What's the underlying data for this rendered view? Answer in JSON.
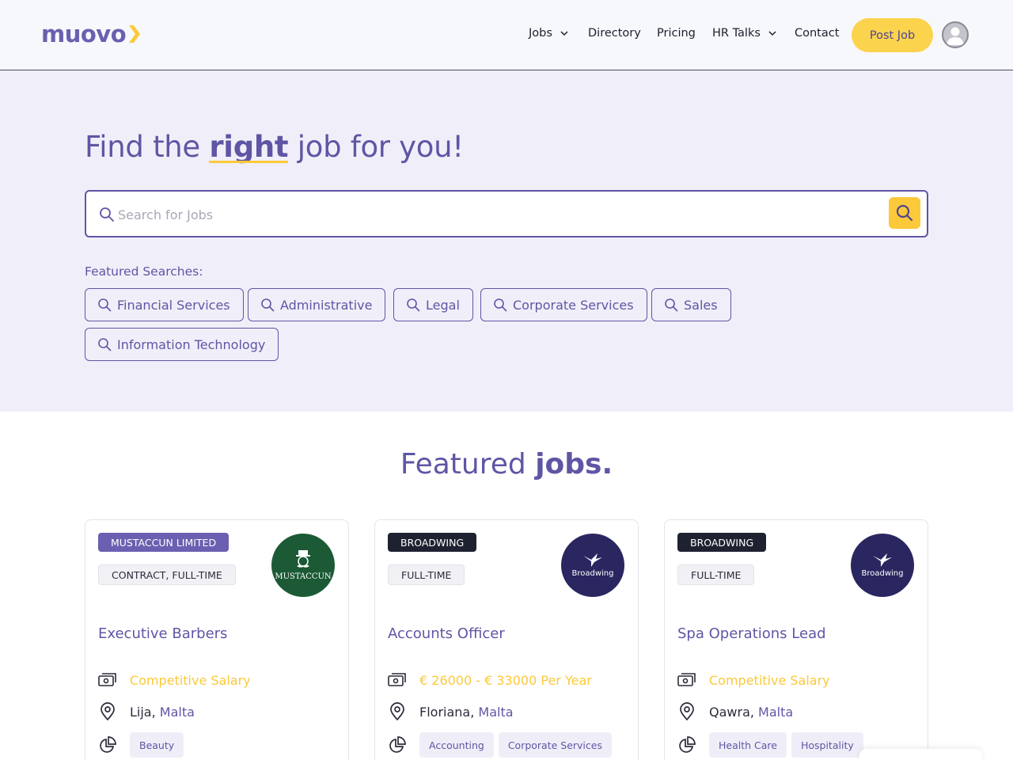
{
  "header": {
    "logo_text": "muovo",
    "nav": [
      {
        "label": "Jobs",
        "has_dropdown": true
      },
      {
        "label": "Directory",
        "has_dropdown": false
      },
      {
        "label": "Pricing",
        "has_dropdown": false
      },
      {
        "label": "HR Talks",
        "has_dropdown": true
      },
      {
        "label": "Contact",
        "has_dropdown": false
      }
    ],
    "post_job_label": "Post Job",
    "avatar_icon": "user-avatar-icon"
  },
  "hero": {
    "title_before": "Find the ",
    "title_highlight": "right",
    "title_after": " job for you!",
    "search": {
      "placeholder": "Search for Jobs",
      "value": ""
    },
    "featured_label": "Featured Searches:",
    "featured_searches": [
      "Financial Services",
      "Administrative",
      "Legal",
      "Corporate Services",
      "Sales",
      "Information Technology"
    ]
  },
  "featured": {
    "title_regular": "Featured ",
    "title_bold": "jobs."
  },
  "jobs": [
    {
      "company": "MUSTACCUN LIMITED",
      "company_badge_color": "#6a5fb0",
      "type": "CONTRACT, FULL-TIME",
      "logo_text": "MUSTACCUN",
      "logo_bg": "#1b5a35",
      "title": "Executive Barbers",
      "salary": "Competitive Salary",
      "city": "Lija",
      "country": "Malta",
      "categories": [
        "Beauty"
      ]
    },
    {
      "company": "BROADWING",
      "company_badge_color": "#1e2230",
      "type": "FULL-TIME",
      "logo_text": "Broadwing",
      "logo_bg": "#2a2660",
      "title": "Accounts Officer",
      "salary": "€ 26000 - € 33000 Per Year",
      "city": "Floriana",
      "country": "Malta",
      "categories": [
        "Accounting",
        "Corporate Services"
      ]
    },
    {
      "company": "BROADWING",
      "company_badge_color": "#1e2230",
      "type": "FULL-TIME",
      "logo_text": "Broadwing",
      "logo_bg": "#2a2660",
      "title": "Spa Operations Lead",
      "salary": "Competitive Salary",
      "city": "Qawra",
      "country": "Malta",
      "categories": [
        "Health Care",
        "Hospitality"
      ]
    }
  ],
  "colors": {
    "brand": "#5e56a4",
    "accent": "#fcc93a"
  }
}
